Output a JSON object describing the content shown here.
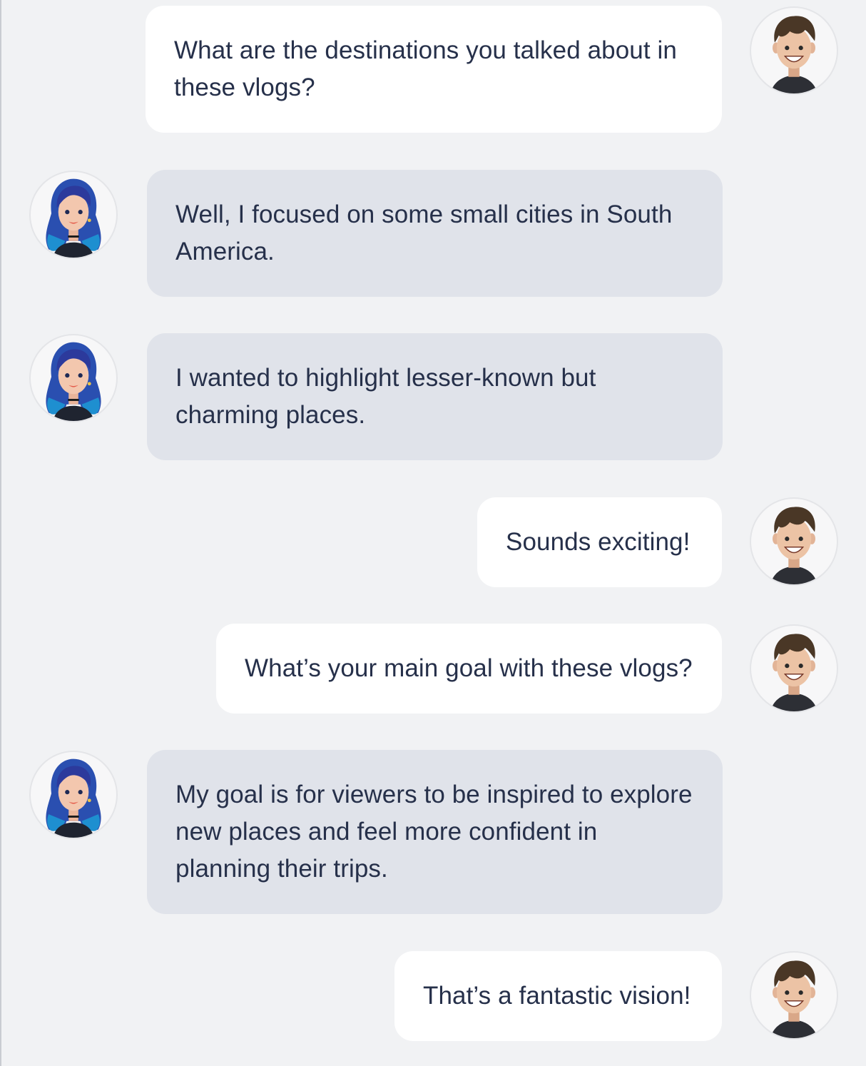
{
  "colors": {
    "background": "#f1f2f4",
    "user_bubble": "#ffffff",
    "bot_bubble": "#e0e3ea",
    "text": "#26304a"
  },
  "avatars": {
    "user": "boy-avatar-icon",
    "bot": "girl-avatar-icon"
  },
  "messages": [
    {
      "role": "user",
      "text": "What are the destinations you talked about in these vlogs?"
    },
    {
      "role": "bot",
      "text": "Well, I focused on some small cities in South America."
    },
    {
      "role": "bot",
      "text": "I wanted to highlight lesser-known but charming places."
    },
    {
      "role": "user",
      "text": "Sounds exciting!"
    },
    {
      "role": "user",
      "text": "What’s your main goal with these vlogs?"
    },
    {
      "role": "bot",
      "text": "My goal is for viewers to be inspired to explore new places and feel more confident in planning their trips."
    },
    {
      "role": "user",
      "text": "That’s a fantastic vision!"
    }
  ]
}
